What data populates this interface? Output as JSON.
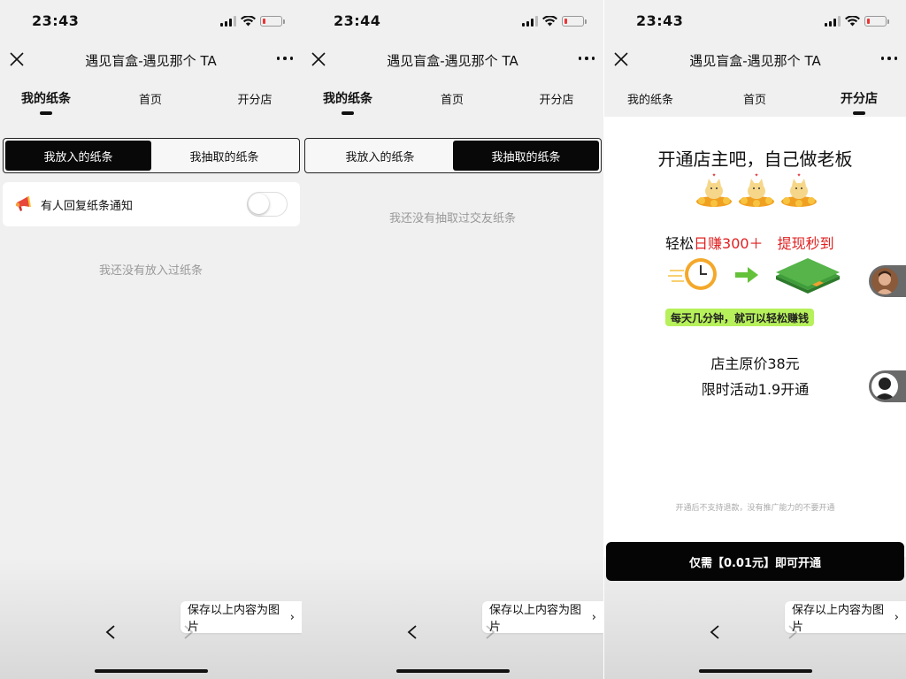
{
  "panels": [
    {
      "status": {
        "time": "23:43"
      },
      "navbar": {
        "title": "遇见盲盒-遇见那个 TA"
      },
      "tabs": [
        "我的纸条",
        "首页",
        "开分店"
      ],
      "segment": [
        "我放入的纸条",
        "我抽取的纸条"
      ],
      "notify_label": "有人回复纸条通知",
      "empty_text": "我还没有放入过纸条",
      "save_label": "保存以上内容为图片"
    },
    {
      "status": {
        "time": "23:44"
      },
      "navbar": {
        "title": "遇见盲盒-遇见那个 TA"
      },
      "tabs": [
        "我的纸条",
        "首页",
        "开分店"
      ],
      "segment": [
        "我放入的纸条",
        "我抽取的纸条"
      ],
      "empty_text": "我还没有抽取过交友纸条",
      "save_label": "保存以上内容为图片"
    },
    {
      "status": {
        "time": "23:43"
      },
      "navbar": {
        "title": "遇见盲盒-遇见那个 TA"
      },
      "tabs": [
        "我的纸条",
        "首页",
        "开分店"
      ],
      "shop": {
        "headline": "开通店主吧，自己做老板",
        "earn_prefix": "轻松",
        "earn_red": "日赚300＋",
        "earn_red2": "提现秒到",
        "pill": "每天几分钟，就可以轻松赚钱",
        "price_original": "店主原价38元",
        "price_promo": "限时活动1.9开通",
        "disclaimer": "开通后不支持退款，没有推广能力的不要开通"
      },
      "open_button": "仅需【0.01元】即可开通",
      "save_label": "保存以上内容为图片"
    }
  ],
  "colors": {
    "accent_red": "#e02020",
    "pill_green": "#b6f05a",
    "dark": "#050505"
  }
}
